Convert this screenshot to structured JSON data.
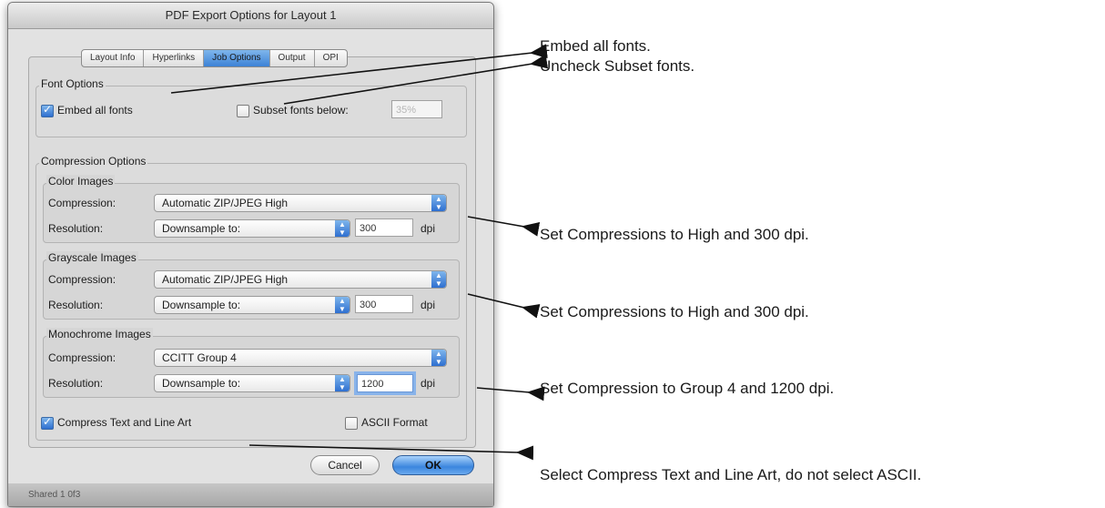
{
  "dialog": {
    "title": "PDF Export Options for Layout 1",
    "tabs": [
      {
        "label": "Layout Info",
        "active": false
      },
      {
        "label": "Hyperlinks",
        "active": false
      },
      {
        "label": "Job Options",
        "active": true
      },
      {
        "label": "Output",
        "active": false
      },
      {
        "label": "OPI",
        "active": false
      }
    ],
    "font_options": {
      "legend": "Font Options",
      "embed_label": "Embed all fonts",
      "embed_checked": true,
      "subset_label": "Subset fonts below:",
      "subset_checked": false,
      "subset_value": "35%"
    },
    "compression_options": {
      "legend": "Compression Options",
      "compression_label": "Compression:",
      "resolution_label": "Resolution:",
      "dpi_label": "dpi",
      "color": {
        "legend": "Color Images",
        "compression": "Automatic ZIP/JPEG High",
        "resolution": "Downsample to:",
        "dpi_value": "300"
      },
      "grayscale": {
        "legend": "Grayscale Images",
        "compression": "Automatic ZIP/JPEG High",
        "resolution": "Downsample to:",
        "dpi_value": "300"
      },
      "monochrome": {
        "legend": "Monochrome Images",
        "compression": "CCITT Group 4",
        "resolution": "Downsample to:",
        "dpi_value": "1200"
      },
      "compress_text_label": "Compress Text and Line Art",
      "compress_text_checked": true,
      "ascii_label": "ASCII Format",
      "ascii_checked": false
    },
    "buttons": {
      "cancel": "Cancel",
      "ok": "OK"
    },
    "statusbar_text": "Shared 1 0f3"
  },
  "annotations": {
    "fonts_line1": "Embed all fonts.",
    "fonts_line2": "Uncheck Subset fonts.",
    "color": "Set Compressions to High and 300 dpi.",
    "grayscale": "Set Compressions to High and 300 dpi.",
    "monochrome": "Set Compression to Group 4 and 1200 dpi.",
    "compress_text": "Select Compress Text and Line Art, do not select ASCII."
  },
  "colors": {
    "accent_blue": "#3c82d6",
    "window_bg": "#e2e2e2",
    "arrow": "#111111"
  }
}
